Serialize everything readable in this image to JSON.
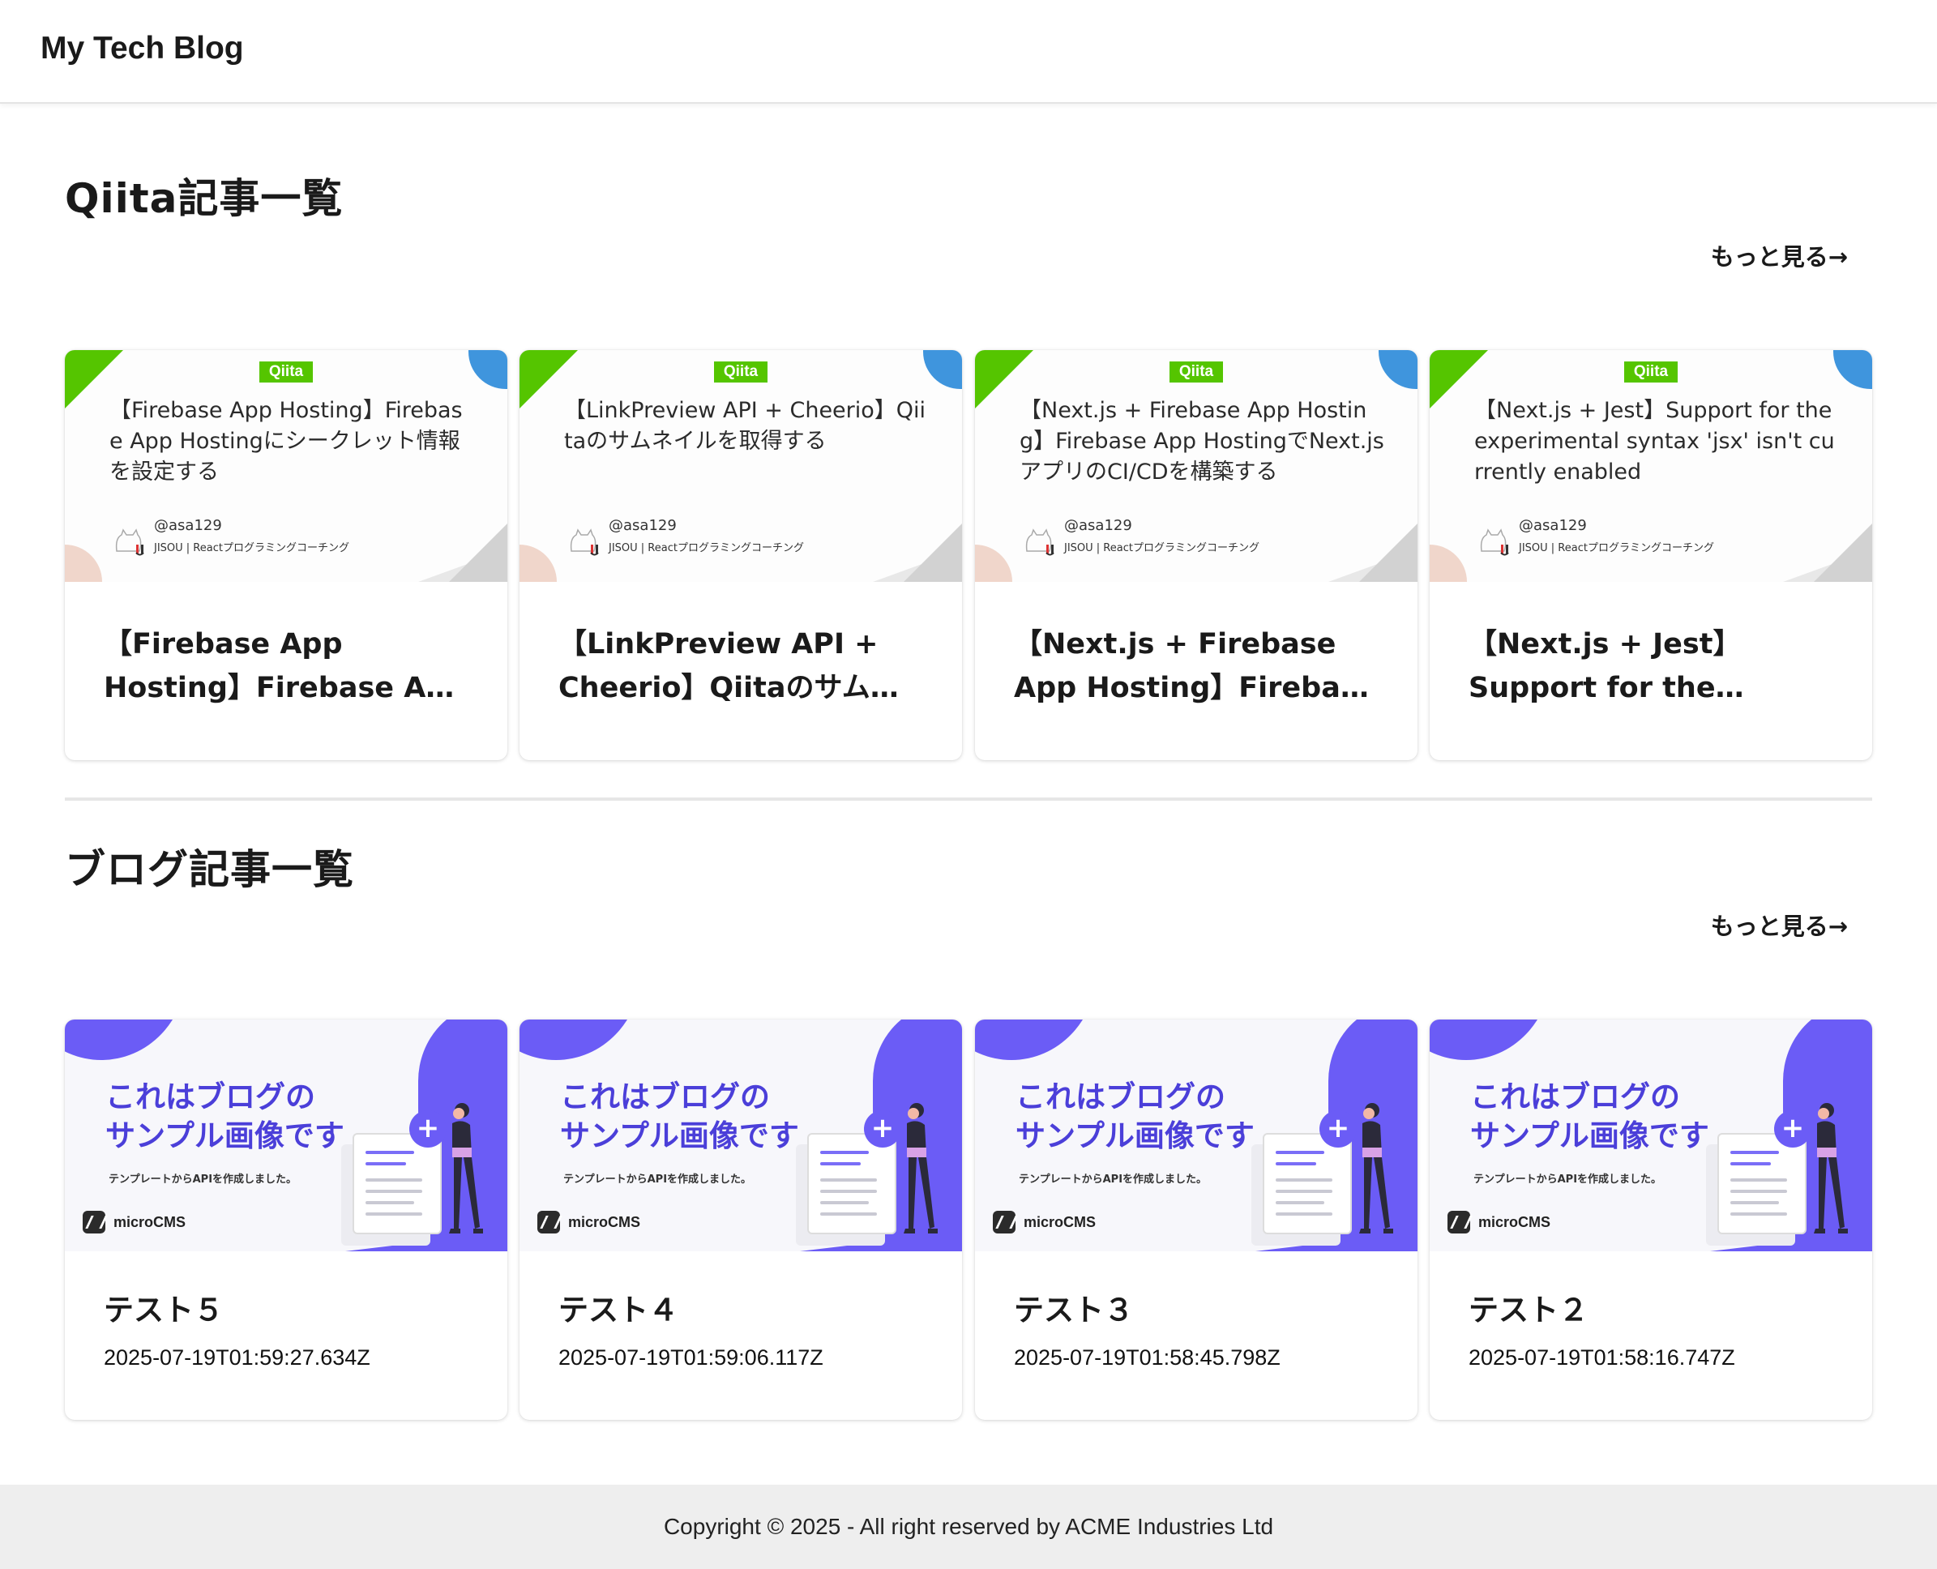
{
  "header": {
    "site_title": "My Tech Blog"
  },
  "qiita_section": {
    "title": "Qiita記事一覧",
    "more_label": "もっと見る→",
    "thumbnail_logo": "Qiita",
    "author": "@asa129",
    "organization": "JISOU | Reactプログラミングコーチング",
    "cards": [
      {
        "thumb_title": "【Firebase App Hosting】Firebase App Hostingにシークレット情報を設定する",
        "title": "【Firebase App Hosting】Firebase App Hostingにシークレット情報を設定する"
      },
      {
        "thumb_title": "【LinkPreview API + Cheerio】Qiitaのサムネイルを取得する",
        "title": "【LinkPreview API + Cheerio】Qiitaのサムネイルを取得する"
      },
      {
        "thumb_title": "【Next.js + Firebase App Hosting】Firebase App HostingでNext.jsアプリのCI/CDを構築する",
        "title": "【Next.js + Firebase App Hosting】Firebase App HostingでNext.jsアプリのCI/CDを構築する"
      },
      {
        "thumb_title": "【Next.js + Jest】Support for the experimental syntax 'jsx' isn't currently enabled",
        "title": "【Next.js + Jest】Support for the experimental syntax 'jsx' isn't currently enabled"
      }
    ]
  },
  "blog_section": {
    "title": "ブログ記事一覧",
    "more_label": "もっと見る→",
    "thumbnail": {
      "headline_line1": "これはブログの",
      "headline_line2": "サンプル画像です",
      "subtext": "テンプレートからAPIを作成しました。",
      "brand": "microCMS"
    },
    "cards": [
      {
        "title": "テスト５",
        "date": "2025-07-19T01:59:27.634Z"
      },
      {
        "title": "テスト４",
        "date": "2025-07-19T01:59:06.117Z"
      },
      {
        "title": "テスト３",
        "date": "2025-07-19T01:58:45.798Z"
      },
      {
        "title": "テスト２",
        "date": "2025-07-19T01:58:16.747Z"
      }
    ]
  },
  "footer": {
    "copyright": "Copyright © 2025 - All right reserved by ACME Industries Ltd"
  },
  "colors": {
    "qiita_green": "#55c500",
    "qiita_blue": "#3f95dd",
    "blog_purple": "#6b5cf6",
    "blog_headline": "#4b3fd9"
  },
  "icons": {
    "avatar": "cat-avatar-icon",
    "microcms": "microcms-logo-icon",
    "plus": "plus-icon"
  }
}
